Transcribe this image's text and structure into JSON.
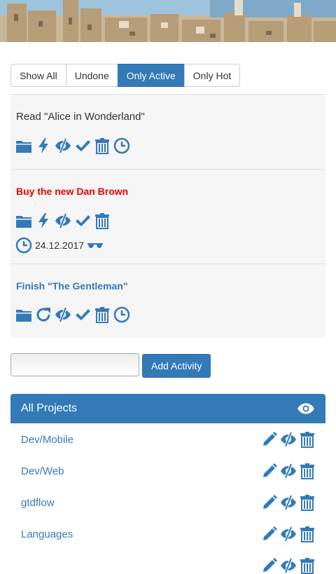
{
  "filters": {
    "items": [
      "Show All",
      "Undone",
      "Only Active",
      "Only Hot"
    ],
    "selected": "Only Active"
  },
  "activities": [
    {
      "title": "Read \"Alice in Wonderland\"",
      "style": "normal",
      "icons": [
        "folder-icon",
        "bolt-icon",
        "eye-slash-icon",
        "check-icon",
        "trash-icon",
        "clock-icon"
      ]
    },
    {
      "title": "Buy the new Dan Brown",
      "style": "hot",
      "icons": [
        "folder-icon",
        "bolt-icon",
        "eye-slash-icon",
        "check-icon",
        "trash-icon"
      ],
      "due_date": "24.12.2017",
      "due_icons": [
        "clock-icon",
        "sunglasses-icon"
      ]
    },
    {
      "title": "Finish \"The Gentleman\"",
      "style": "active",
      "icons": [
        "folder-icon",
        "refresh-icon",
        "eye-slash-icon",
        "check-icon",
        "trash-icon",
        "clock-icon"
      ]
    }
  ],
  "add_activity": {
    "input_value": "",
    "button_label": "Add Activity"
  },
  "projects": {
    "header_label": "All Projects",
    "header_icon": "eye-icon",
    "items": [
      {
        "name": "Dev/Mobile"
      },
      {
        "name": "Dev/Web"
      },
      {
        "name": "gtdflow"
      },
      {
        "name": "Languages"
      }
    ],
    "row_icons": [
      "pencil-icon",
      "eye-slash-icon",
      "trash-icon"
    ]
  },
  "colors": {
    "primary": "#337ab7",
    "hot": "#e60000"
  }
}
